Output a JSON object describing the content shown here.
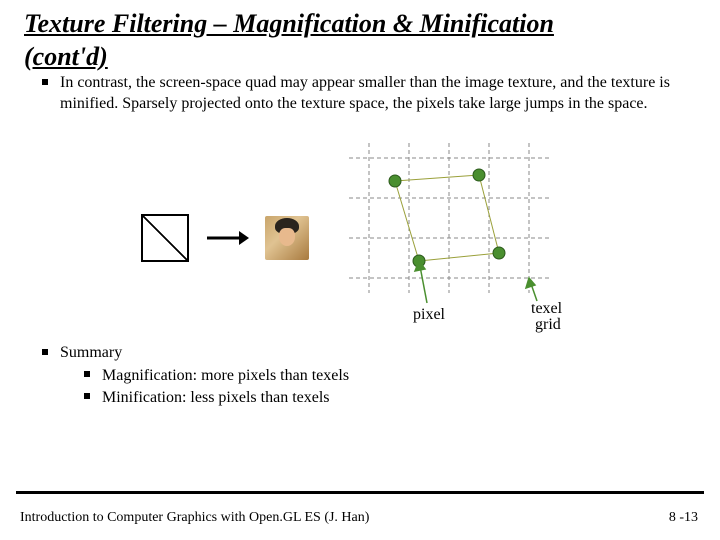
{
  "title_line1": "Texture Filtering – Magnification & Minification",
  "title_line2": "(cont'd)",
  "bullets": {
    "main": "In contrast, the screen-space quad may appear smaller than the image texture, and the texture is minified. Sparsely projected onto the texture space, the pixels take large jumps in the space.",
    "summary_label": "Summary",
    "summary_items": {
      "a": "Magnification: more pixels than texels",
      "b": "Minification: less pixels than texels"
    }
  },
  "labels": {
    "pixel": "pixel",
    "texel_grid_1": "texel",
    "texel_grid_2": "grid"
  },
  "footer": "Introduction to Computer Graphics with Open.GL ES (J. Han)",
  "page": "8 -13"
}
